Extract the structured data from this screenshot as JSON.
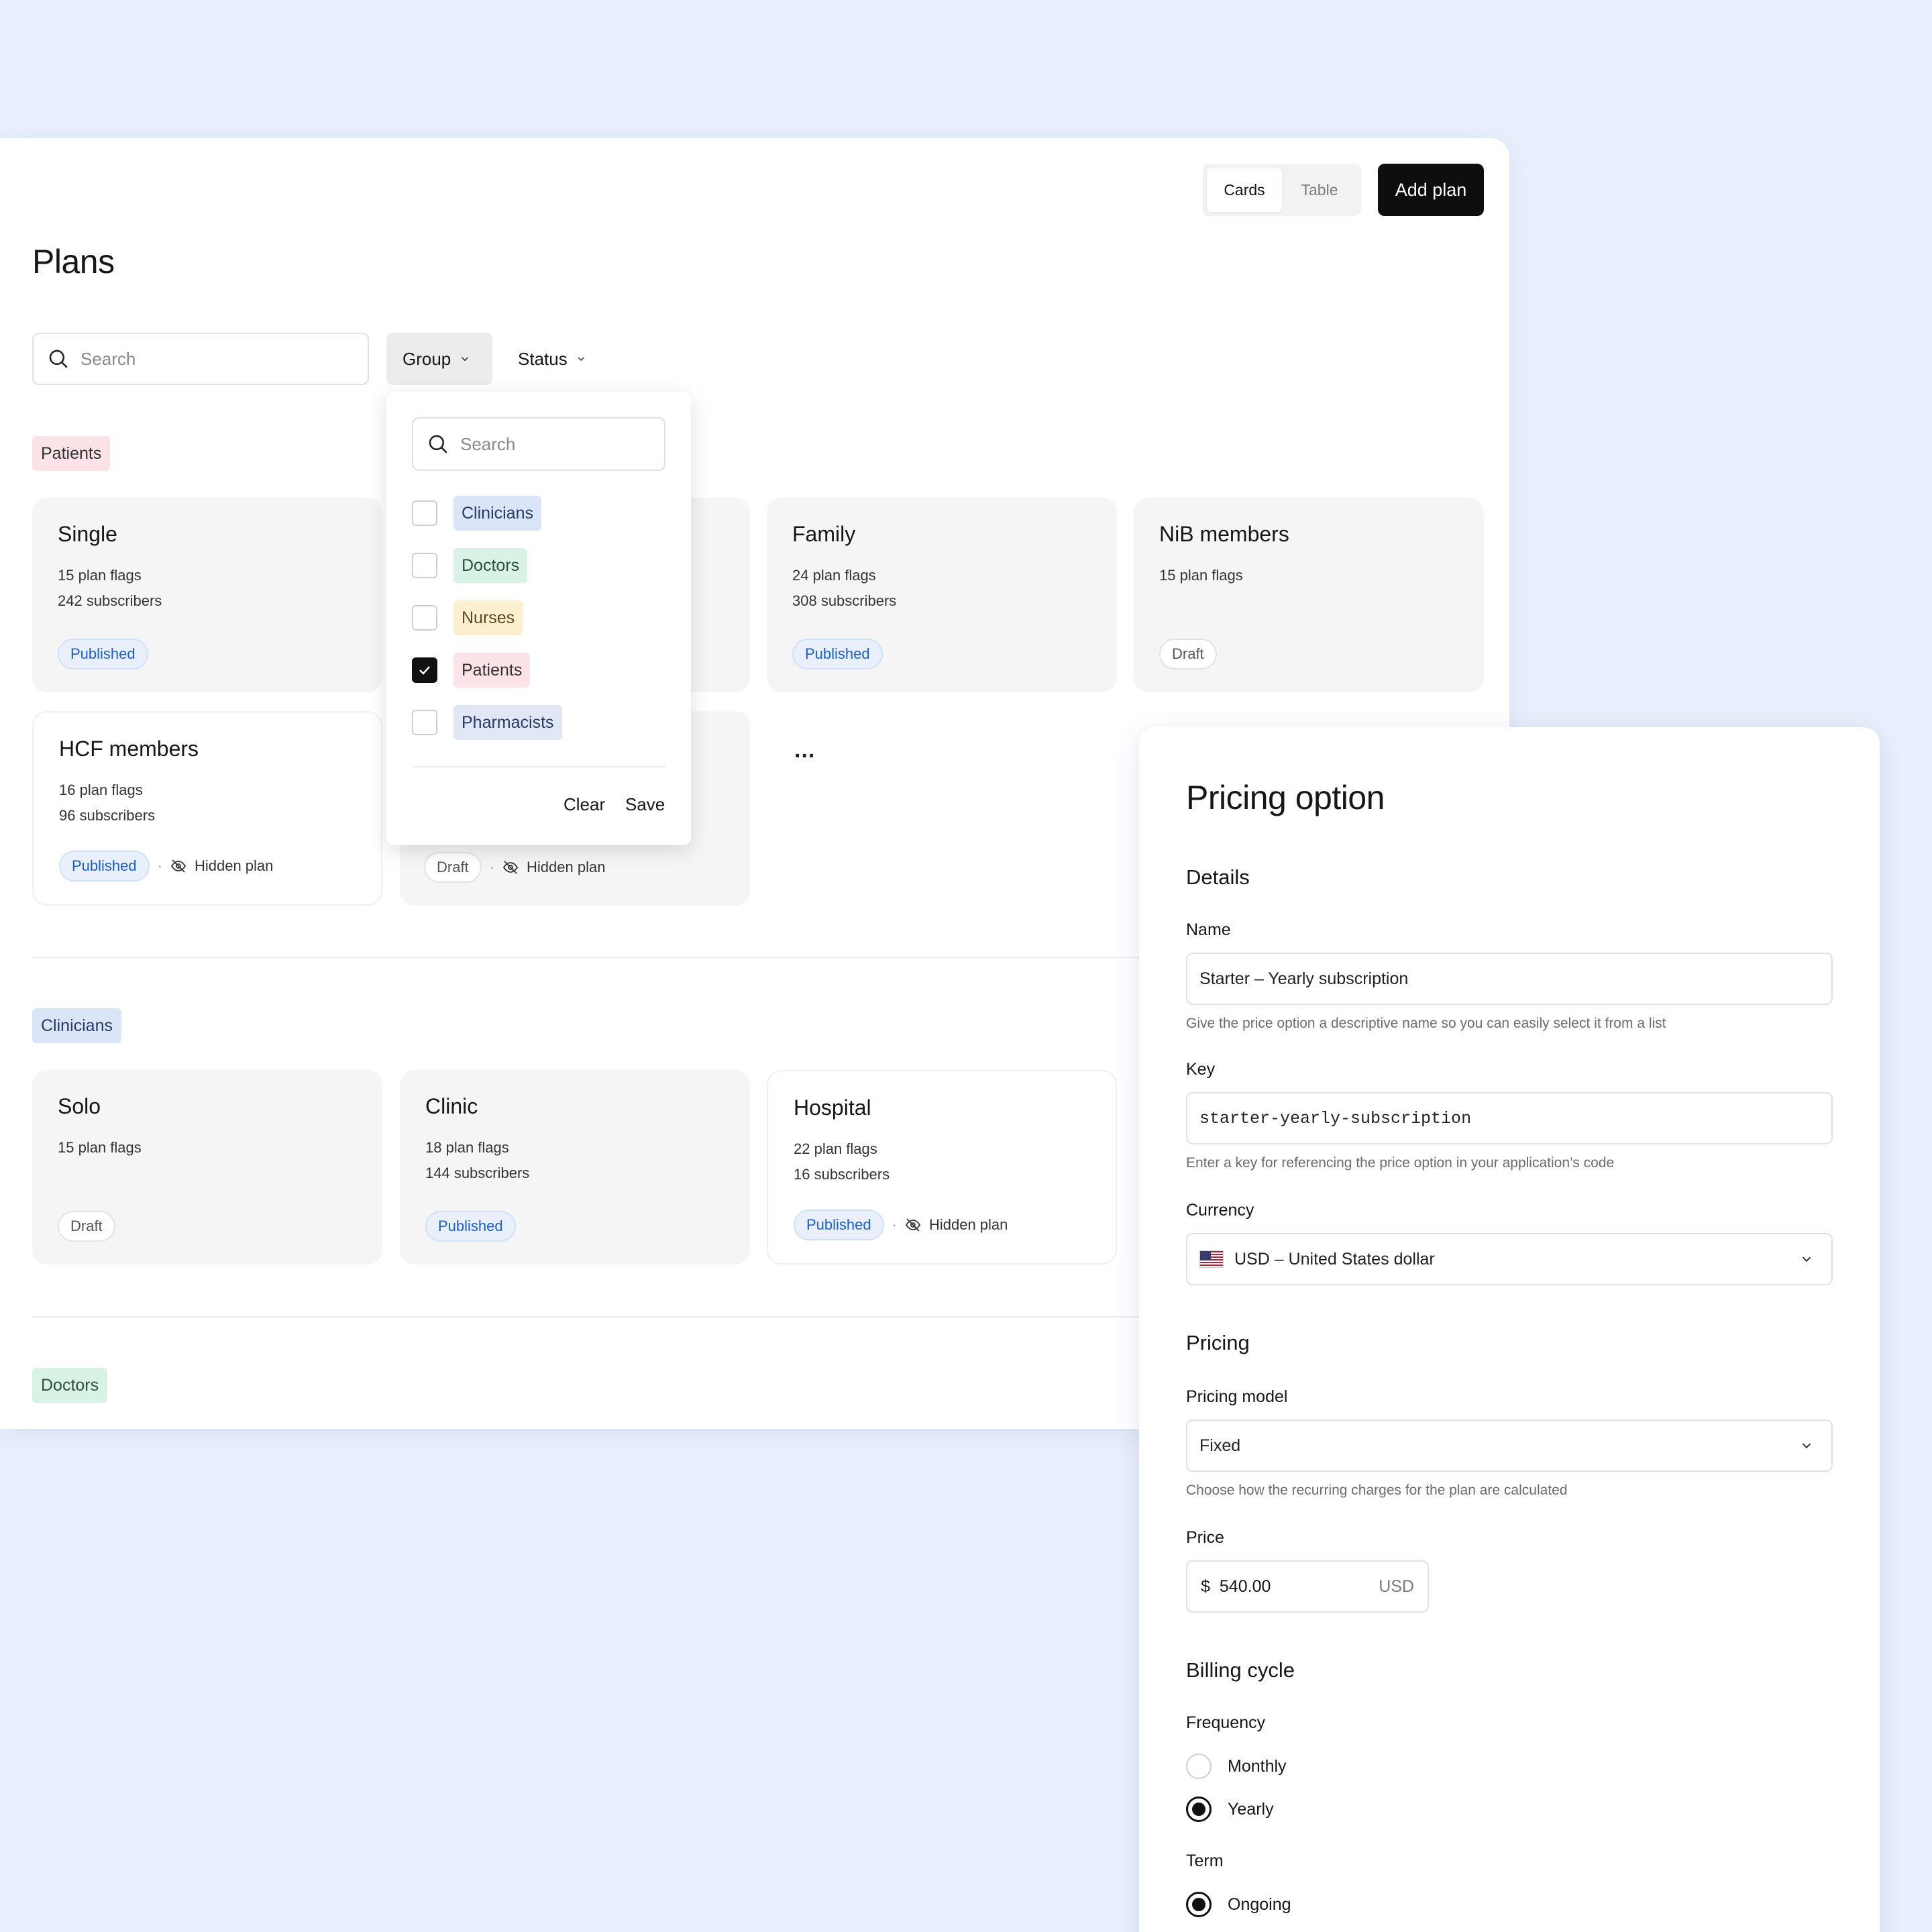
{
  "header": {
    "view_toggle": [
      "Cards",
      "Table"
    ],
    "active_view": "Cards",
    "add_plan_label": "Add plan",
    "title": "Plans"
  },
  "filters": {
    "search_placeholder": "Search",
    "group_label": "Group",
    "status_label": "Status"
  },
  "groups": [
    {
      "tag": "Patients",
      "cards": [
        {
          "title": "Single",
          "flags": "15 plan flags",
          "subscribers": "242 subscribers",
          "status": "Published",
          "hidden": ""
        },
        {
          "title": "Family",
          "flags": "24 plan flags",
          "subscribers": "308 subscribers",
          "status": "Published",
          "hidden": ""
        },
        {
          "title": "NiB members",
          "flags": "15 plan flags",
          "subscribers": "",
          "status": "Draft",
          "hidden": ""
        },
        {
          "title": "HCF members",
          "flags": "16 plan flags",
          "subscribers": "96 subscribers",
          "status": "Published",
          "hidden": "Hidden plan"
        },
        {
          "title": "",
          "flags": "",
          "subscribers": "",
          "status": "Draft",
          "hidden": "Hidden plan"
        }
      ]
    },
    {
      "tag": "Clinicians",
      "cards": [
        {
          "title": "Solo",
          "flags": "15 plan flags",
          "subscribers": "",
          "status": "Draft",
          "hidden": ""
        },
        {
          "title": "Clinic",
          "flags": "18 plan flags",
          "subscribers": "144 subscribers",
          "status": "Published",
          "hidden": ""
        },
        {
          "title": "Hospital",
          "flags": "22 plan flags",
          "subscribers": "16 subscribers",
          "status": "Published",
          "hidden": "Hidden plan"
        }
      ]
    },
    {
      "tag": "Doctors",
      "cards": []
    }
  ],
  "more_label": "...",
  "group_dropdown": {
    "search_placeholder": "Search",
    "options": [
      {
        "label": "Clinicians",
        "checked": false
      },
      {
        "label": "Doctors",
        "checked": false
      },
      {
        "label": "Nurses",
        "checked": false
      },
      {
        "label": "Patients",
        "checked": true
      },
      {
        "label": "Pharmacists",
        "checked": false
      }
    ],
    "clear_label": "Clear",
    "save_label": "Save"
  },
  "pricing_option": {
    "title": "Pricing option",
    "details_heading": "Details",
    "name_label": "Name",
    "name_value": "Starter – Yearly subscription",
    "name_help": "Give the price option a descriptive name so you can easily select it from a list",
    "key_label": "Key",
    "key_value": "starter-yearly-subscription",
    "key_help": "Enter a key for referencing the price option in your application’s code",
    "currency_label": "Currency",
    "currency_value": "USD – United States dollar",
    "pricing_heading": "Pricing",
    "pricing_model_label": "Pricing model",
    "pricing_model_value": "Fixed",
    "pricing_model_help": "Choose how the recurring charges for the plan are calculated",
    "price_label": "Price",
    "price_symbol": "$",
    "price_value": "540.00",
    "price_unit": "USD",
    "billing_heading": "Billing cycle",
    "frequency_label": "Frequency",
    "frequency_options": [
      {
        "label": "Monthly",
        "selected": false
      },
      {
        "label": "Yearly",
        "selected": true
      }
    ],
    "term_label": "Term",
    "term_options": [
      {
        "label": "Ongoing",
        "selected": true
      }
    ]
  },
  "colors": {
    "background": "#e9effc",
    "primary_button": "#0e0e0e",
    "published": "#1a5fd0"
  }
}
